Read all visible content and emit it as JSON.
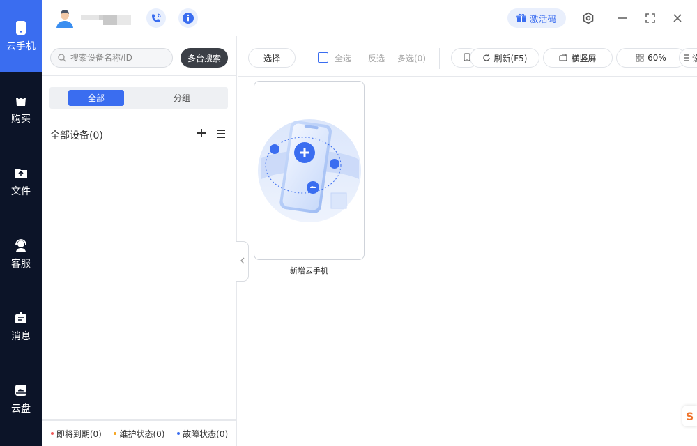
{
  "rail": {
    "items": [
      {
        "label": "云手机",
        "icon": "phone-icon",
        "active": true
      },
      {
        "label": "购买",
        "icon": "shopping-bag-icon"
      },
      {
        "label": "文件",
        "icon": "folder-upload-icon"
      },
      {
        "label": "客服",
        "icon": "headset-icon"
      },
      {
        "label": "消息",
        "icon": "message-icon"
      },
      {
        "label": "云盘",
        "icon": "cloud-disk-icon"
      }
    ]
  },
  "header": {
    "activation_code": "激活码"
  },
  "device_panel": {
    "search_placeholder": "搜索设备名称/ID",
    "multi_search": "多台搜索",
    "tab_all": "全部",
    "tab_group": "分组",
    "all_devices": "全部设备(0)",
    "status": {
      "expiring": "即将到期(0)",
      "maintenance": "维护状态(0)",
      "fault": "故障状态(0)"
    }
  },
  "toolbar": {
    "select": "选择",
    "select_all": "全选",
    "invert": "反选",
    "multi_select": "多选(0)",
    "refresh": "刷新(F5)",
    "orientation": "横竖屏",
    "zoom": "60%",
    "more": "设"
  },
  "main": {
    "new_phone_label": "新增云手机"
  },
  "colors": {
    "accent": "#3a6df0",
    "rail_bg": "#0c1428",
    "status_expiring": "#f05a5a",
    "status_maintenance": "#f5a623",
    "status_fault": "#3a6df0"
  }
}
